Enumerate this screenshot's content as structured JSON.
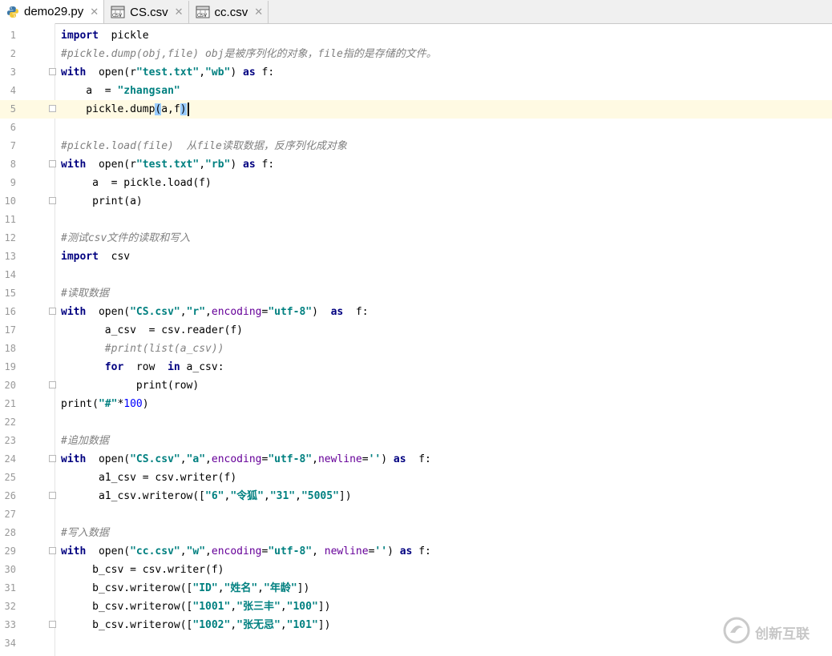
{
  "tabs": [
    {
      "label": "demo29.py",
      "icon": "python-file-icon",
      "active": true
    },
    {
      "label": "CS.csv",
      "icon": "csv-file-icon",
      "active": false
    },
    {
      "label": "cc.csv",
      "icon": "csv-file-icon",
      "active": false
    }
  ],
  "editor": {
    "current_line": 5,
    "lines": [
      {
        "n": "1",
        "t": "import  pickle"
      },
      {
        "n": "2",
        "t": "#pickle.dump(obj,file) obj是被序列化的对象，file指的是存储的文件。"
      },
      {
        "n": "3",
        "t": "with  open(r\"test.txt\",\"wb\") as f:"
      },
      {
        "n": "4",
        "t": "    a  = \"zhangsan\""
      },
      {
        "n": "5",
        "t": "    pickle.dump(a,f)"
      },
      {
        "n": "6",
        "t": ""
      },
      {
        "n": "7",
        "t": "#pickle.load(file)  从file读取数据，反序列化成对象"
      },
      {
        "n": "8",
        "t": "with  open(r\"test.txt\",\"rb\") as f:"
      },
      {
        "n": "9",
        "t": "     a  = pickle.load(f)"
      },
      {
        "n": "10",
        "t": "     print(a)"
      },
      {
        "n": "11",
        "t": ""
      },
      {
        "n": "12",
        "t": "#测试csv文件的读取和写入"
      },
      {
        "n": "13",
        "t": "import  csv"
      },
      {
        "n": "14",
        "t": ""
      },
      {
        "n": "15",
        "t": "#读取数据"
      },
      {
        "n": "16",
        "t": "with  open(\"CS.csv\",\"r\",encoding=\"utf-8\")  as  f:"
      },
      {
        "n": "17",
        "t": "       a_csv  = csv.reader(f)"
      },
      {
        "n": "18",
        "t": "       #print(list(a_csv))"
      },
      {
        "n": "19",
        "t": "       for  row  in a_csv:"
      },
      {
        "n": "20",
        "t": "            print(row)"
      },
      {
        "n": "21",
        "t": "print(\"#\"*100)"
      },
      {
        "n": "22",
        "t": ""
      },
      {
        "n": "23",
        "t": "#追加数据"
      },
      {
        "n": "24",
        "t": "with  open(\"CS.csv\",\"a\",encoding=\"utf-8\",newline='') as  f:"
      },
      {
        "n": "25",
        "t": "      a1_csv = csv.writer(f)"
      },
      {
        "n": "26",
        "t": "      a1_csv.writerow([\"6\",\"令狐\",\"31\",\"5005\"])"
      },
      {
        "n": "27",
        "t": ""
      },
      {
        "n": "28",
        "t": "#写入数据"
      },
      {
        "n": "29",
        "t": "with  open(\"cc.csv\",\"w\",encoding=\"utf-8\", newline='') as f:"
      },
      {
        "n": "30",
        "t": "     b_csv = csv.writer(f)"
      },
      {
        "n": "31",
        "t": "     b_csv.writerow([\"ID\",\"姓名\",\"年龄\"])"
      },
      {
        "n": "32",
        "t": "     b_csv.writerow([\"1001\",\"张三丰\",\"100\"])"
      },
      {
        "n": "33",
        "t": "     b_csv.writerow([\"1002\",\"张无忌\",\"101\"])"
      },
      {
        "n": "34",
        "t": ""
      }
    ]
  },
  "watermark": {
    "text": "创新互联",
    "icon": "brand-logo-icon"
  },
  "colors": {
    "keyword": "#000080",
    "string": "#008080",
    "comment": "#808080",
    "param": "#660099",
    "number": "#0000ff",
    "current_line": "#fffae3"
  }
}
